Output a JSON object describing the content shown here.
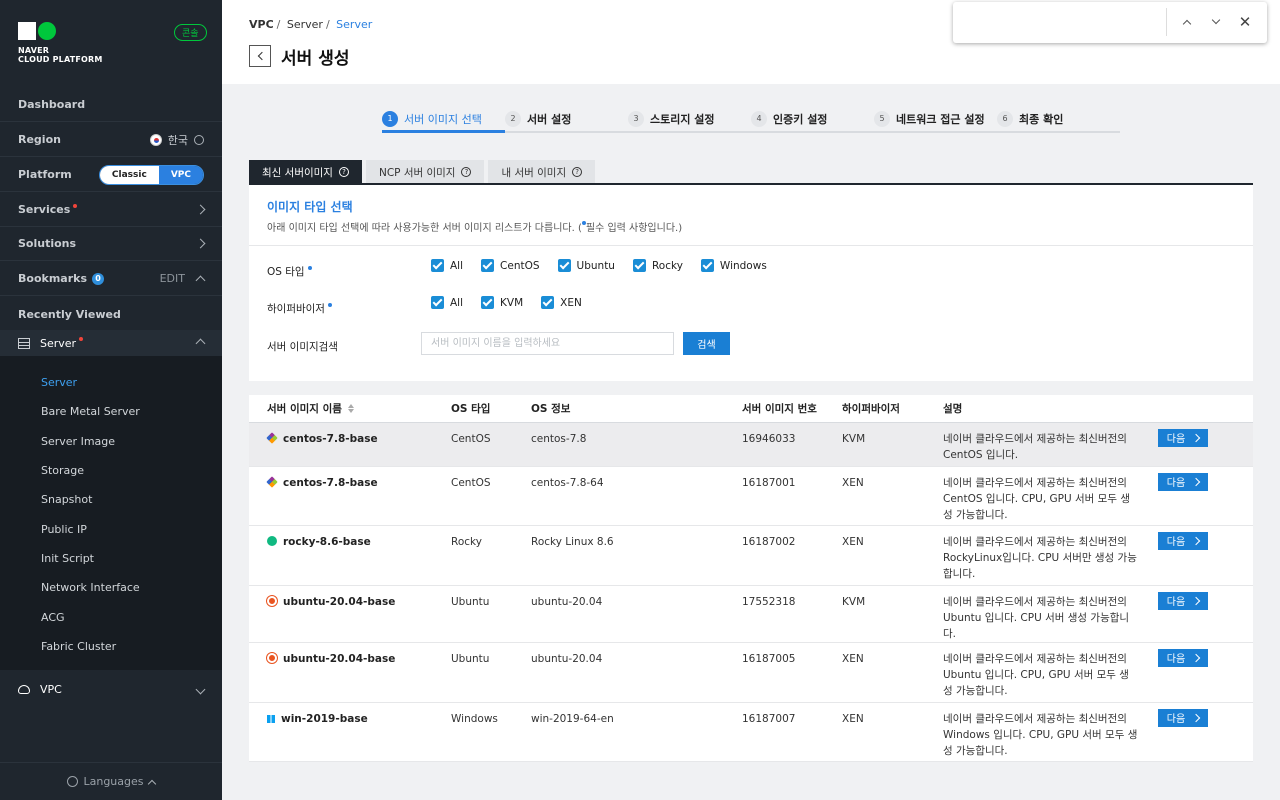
{
  "sidebar": {
    "logo_line1": "NAVER",
    "logo_line2": "CLOUD PLATFORM",
    "console_badge": "콘솔",
    "dashboard": "Dashboard",
    "region_label": "Region",
    "region_value": "한국",
    "platform_label": "Platform",
    "platform_classic": "Classic",
    "platform_vpc": "VPC",
    "services": "Services",
    "solutions": "Solutions",
    "bookmarks": "Bookmarks",
    "bookmarks_count": "0",
    "bookmarks_edit": "EDIT",
    "recently_viewed": "Recently Viewed",
    "server": "Server",
    "server_items": [
      "Server",
      "Bare Metal Server",
      "Server Image",
      "Storage",
      "Snapshot",
      "Public IP",
      "Init Script",
      "Network Interface",
      "ACG",
      "Fabric Cluster"
    ],
    "vpc": "VPC",
    "languages": "Languages"
  },
  "header": {
    "crumb1": "VPC",
    "crumb2": "Server",
    "crumb3": "Server",
    "title": "서버 생성"
  },
  "steps": [
    {
      "num": "1",
      "label": "서버 이미지 선택"
    },
    {
      "num": "2",
      "label": "서버 설정"
    },
    {
      "num": "3",
      "label": "스토리지 설정"
    },
    {
      "num": "4",
      "label": "인증키 설정"
    },
    {
      "num": "5",
      "label": "네트워크 접근 설정"
    },
    {
      "num": "6",
      "label": "최종 확인"
    }
  ],
  "tabs": [
    "최신 서버이미지",
    "NCP 서버 이미지",
    "내 서버 이미지"
  ],
  "filter": {
    "title": "이미지 타입 선택",
    "desc_pre": "아래 이미지 타입 선택에 따라 사용가능한 서버 이미지 리스트가 다릅니다. (",
    "desc_post": "필수 입력 사항입니다.)",
    "os_label": "OS 타입",
    "os_options": [
      "All",
      "CentOS",
      "Ubuntu",
      "Rocky",
      "Windows"
    ],
    "hv_label": "하이퍼바이저",
    "hv_options": [
      "All",
      "KVM",
      "XEN"
    ],
    "search_label": "서버 이미지검색",
    "search_placeholder": "서버 이미지 이름을 입력하세요",
    "search_button": "검색"
  },
  "table": {
    "headers": [
      "서버 이미지 이름",
      "OS 타입",
      "OS 정보",
      "서버 이미지 번호",
      "하이퍼바이저",
      "설명"
    ],
    "next_label": "다음",
    "rows": [
      {
        "name": "centos-7.8-base",
        "icon": "centos",
        "os": "CentOS",
        "info": "centos-7.8",
        "no": "16946033",
        "hv": "KVM",
        "desc": "네이버 클라우드에서 제공하는 최신버전의 CentOS 입니다."
      },
      {
        "name": "centos-7.8-base",
        "icon": "centos",
        "os": "CentOS",
        "info": "centos-7.8-64",
        "no": "16187001",
        "hv": "XEN",
        "desc": "네이버 클라우드에서 제공하는 최신버전의 CentOS 입니다. CPU, GPU 서버 모두 생성 가능합니다."
      },
      {
        "name": "rocky-8.6-base",
        "icon": "rocky",
        "os": "Rocky",
        "info": "Rocky Linux 8.6",
        "no": "16187002",
        "hv": "XEN",
        "desc": "네이버 클라우드에서 제공하는 최신버전의 RockyLinux입니다. CPU 서버만 생성 가능합니다."
      },
      {
        "name": "ubuntu-20.04-base",
        "icon": "ubuntu",
        "os": "Ubuntu",
        "info": "ubuntu-20.04",
        "no": "17552318",
        "hv": "KVM",
        "desc": "네이버 클라우드에서 제공하는 최신버전의 Ubuntu 입니다. CPU 서버 생성 가능합니다."
      },
      {
        "name": "ubuntu-20.04-base",
        "icon": "ubuntu",
        "os": "Ubuntu",
        "info": "ubuntu-20.04",
        "no": "16187005",
        "hv": "XEN",
        "desc": "네이버 클라우드에서 제공하는 최신버전의 Ubuntu 입니다. CPU, GPU 서버 모두 생성 가능합니다."
      },
      {
        "name": "win-2019-base",
        "icon": "windows",
        "os": "Windows",
        "info": "win-2019-64-en",
        "no": "16187007",
        "hv": "XEN",
        "desc": "네이버 클라우드에서 제공하는 최신버전의 Windows 입니다. CPU, GPU 서버 모두 생성 가능합니다."
      }
    ]
  },
  "colors": {
    "accent": "#2b80e0",
    "sidebar_bg": "#1f262e",
    "brand_green": "#00c73c"
  }
}
